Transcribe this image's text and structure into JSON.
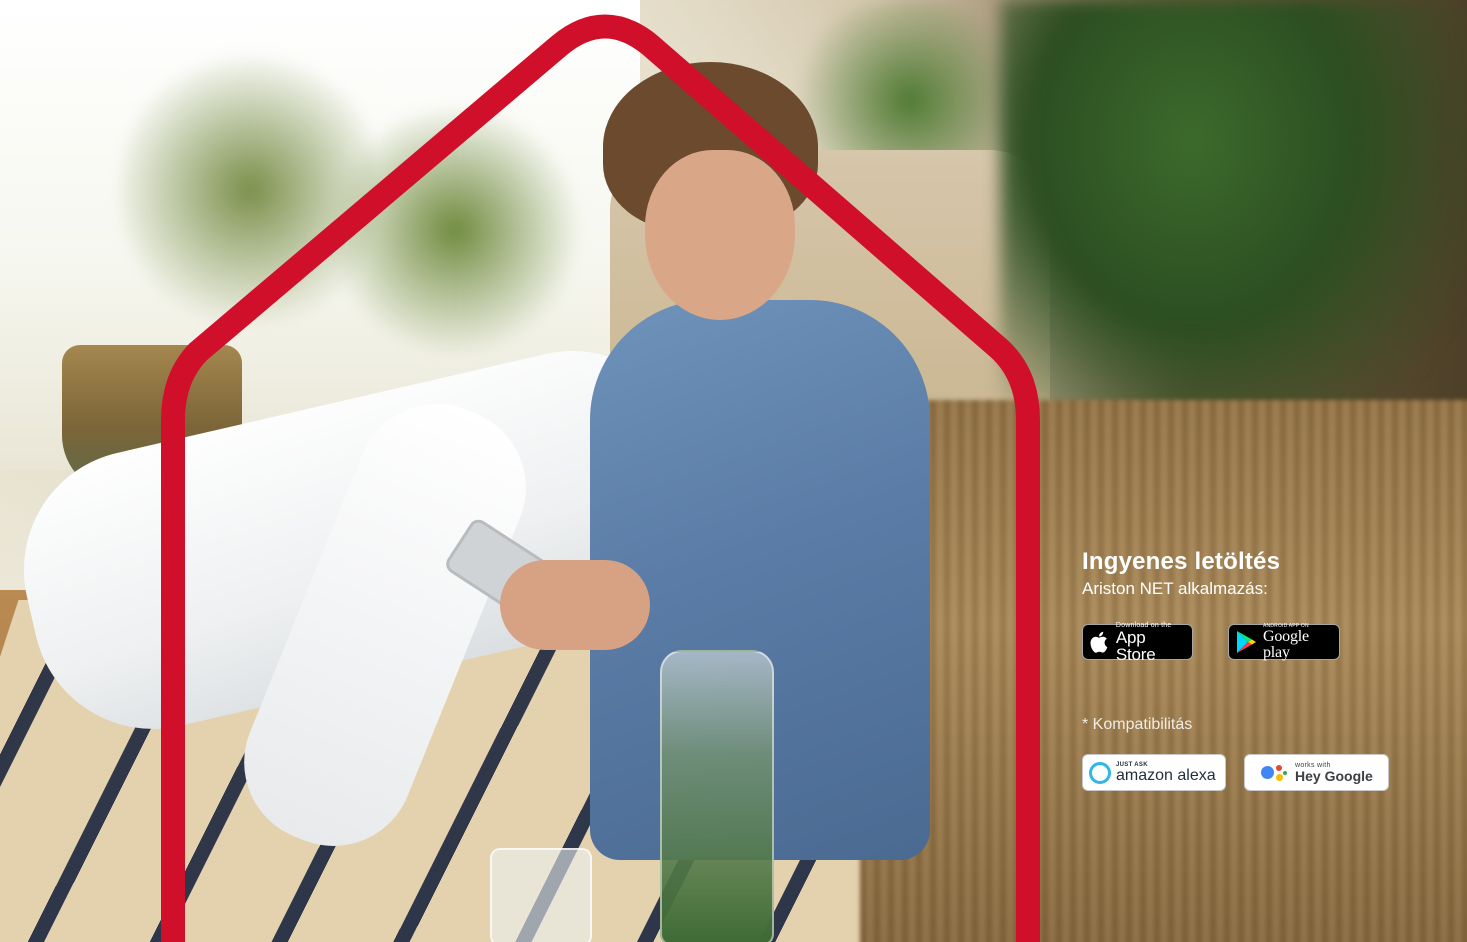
{
  "promo": {
    "title": "Ingyenes letöltés",
    "subtitle": "Ariston NET alkalmazás:",
    "compat_label": "* Kompatibilitás"
  },
  "app_store": {
    "small": "Download on the",
    "big": "App Store",
    "icon": "apple-icon"
  },
  "google_play": {
    "small": "ANDROID APP ON",
    "big": "Google play",
    "icon": "play-triangle-icon"
  },
  "alexa": {
    "small": "JUST ASK",
    "big": "amazon alexa",
    "icon": "alexa-ring-icon"
  },
  "hey_google": {
    "small": "works with",
    "big": "Hey Google",
    "icon": "google-assistant-dots-icon"
  },
  "colors": {
    "house_outline": "#d0102a",
    "alexa_ring": "#2fb7e9",
    "text": "#ffffff"
  }
}
